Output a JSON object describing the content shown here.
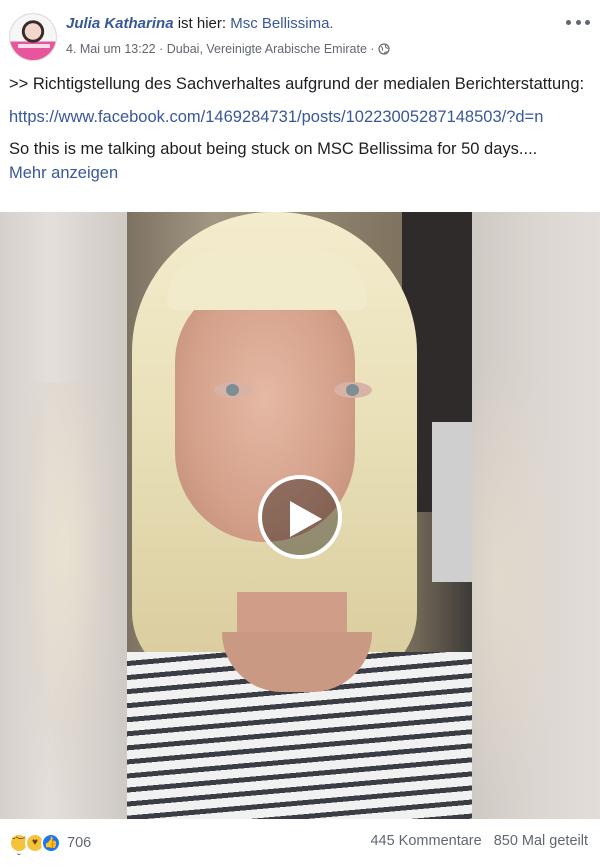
{
  "header": {
    "author": "Julia Katharina",
    "is_here": "ist hier:",
    "place": "Msc Bellissima.",
    "date": "4. Mai um 13:22",
    "dot1": "·",
    "location": "Dubai, Vereinigte Arabische Emirate",
    "dot2": "·",
    "privacy_icon": "globe-icon",
    "more_icon": "more-options-icon"
  },
  "body": {
    "line1": ">> Richtigstellung des Sachverhaltes aufgrund der medialen Berichterstattung:",
    "link": "https://www.facebook.com/1469284731/posts/10223005287148503/?d=n",
    "line2": "So this is me talking about being stuck on MSC Bellissima for 50 days....",
    "see_more": "Mehr anzeigen"
  },
  "video": {
    "play_icon": "play-icon"
  },
  "footer": {
    "reaction_icons": [
      "sad-icon",
      "care-icon",
      "like-icon"
    ],
    "reaction_count": "706",
    "comments": "445 Kommentare",
    "shares": "850 Mal geteilt"
  },
  "colors": {
    "link": "#385898",
    "meta": "#616770",
    "like_blue": "#1877f2",
    "emoji_yellow": "#f5c33b"
  }
}
